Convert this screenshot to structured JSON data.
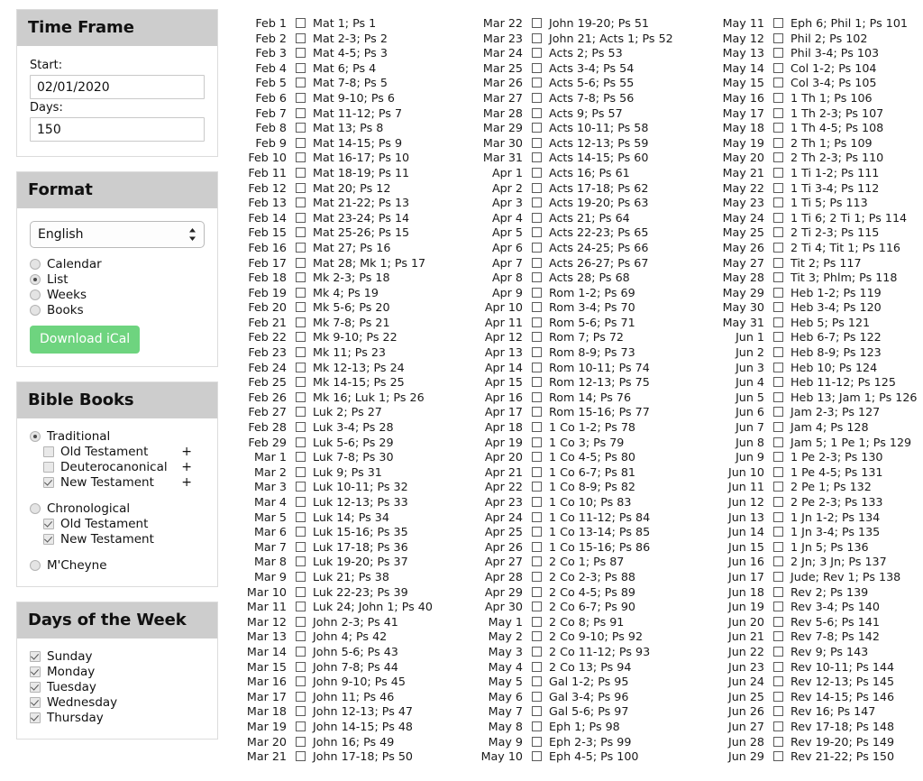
{
  "sidebar": {
    "time_frame": {
      "title": "Time Frame",
      "start_label": "Start:",
      "start_value": "02/01/2020",
      "start_placeholder": "mm/dd/yyyy",
      "days_label": "Days:",
      "days_value": "150",
      "days_placeholder": "Days"
    },
    "format": {
      "title": "Format",
      "language_selected": "English",
      "language_options": [
        "English"
      ],
      "options": [
        {
          "label": "Calendar",
          "selected": false
        },
        {
          "label": "List",
          "selected": true
        },
        {
          "label": "Weeks",
          "selected": false
        },
        {
          "label": "Books",
          "selected": false
        }
      ],
      "download_label": "Download iCal",
      "download_color": "#6ed47f"
    },
    "bible_books": {
      "title": "Bible Books",
      "groups": [
        {
          "label": "Traditional",
          "selected": true,
          "children": [
            {
              "label": "Old Testament",
              "checked": false,
              "expander": "+"
            },
            {
              "label": "Deuterocanonical",
              "checked": false,
              "expander": "+"
            },
            {
              "label": "New Testament",
              "checked": true,
              "expander": "+"
            }
          ]
        },
        {
          "label": "Chronological",
          "selected": false,
          "children": [
            {
              "label": "Old Testament",
              "checked": true,
              "expander": ""
            },
            {
              "label": "New Testament",
              "checked": true,
              "expander": ""
            }
          ]
        },
        {
          "label": "M'Cheyne",
          "selected": false,
          "children": []
        }
      ]
    },
    "days_of_week": {
      "title": "Days of the Week",
      "days": [
        {
          "label": "Sunday",
          "checked": true
        },
        {
          "label": "Monday",
          "checked": true
        },
        {
          "label": "Tuesday",
          "checked": true
        },
        {
          "label": "Wednesday",
          "checked": true
        },
        {
          "label": "Thursday",
          "checked": true
        }
      ]
    }
  },
  "reading_plan": {
    "columns": [
      [
        {
          "date": "Feb 1",
          "reading": "Mat 1; Ps 1"
        },
        {
          "date": "Feb 2",
          "reading": "Mat 2-3; Ps 2"
        },
        {
          "date": "Feb 3",
          "reading": "Mat 4-5; Ps 3"
        },
        {
          "date": "Feb 4",
          "reading": "Mat 6; Ps 4"
        },
        {
          "date": "Feb 5",
          "reading": "Mat 7-8; Ps 5"
        },
        {
          "date": "Feb 6",
          "reading": "Mat 9-10; Ps 6"
        },
        {
          "date": "Feb 7",
          "reading": "Mat 11-12; Ps 7"
        },
        {
          "date": "Feb 8",
          "reading": "Mat 13; Ps 8"
        },
        {
          "date": "Feb 9",
          "reading": "Mat 14-15; Ps 9"
        },
        {
          "date": "Feb 10",
          "reading": "Mat 16-17; Ps 10"
        },
        {
          "date": "Feb 11",
          "reading": "Mat 18-19; Ps 11"
        },
        {
          "date": "Feb 12",
          "reading": "Mat 20; Ps 12"
        },
        {
          "date": "Feb 13",
          "reading": "Mat 21-22; Ps 13"
        },
        {
          "date": "Feb 14",
          "reading": "Mat 23-24; Ps 14"
        },
        {
          "date": "Feb 15",
          "reading": "Mat 25-26; Ps 15"
        },
        {
          "date": "Feb 16",
          "reading": "Mat 27; Ps 16"
        },
        {
          "date": "Feb 17",
          "reading": "Mat 28; Mk 1; Ps 17"
        },
        {
          "date": "Feb 18",
          "reading": "Mk 2-3; Ps 18"
        },
        {
          "date": "Feb 19",
          "reading": "Mk 4; Ps 19"
        },
        {
          "date": "Feb 20",
          "reading": "Mk 5-6; Ps 20"
        },
        {
          "date": "Feb 21",
          "reading": "Mk 7-8; Ps 21"
        },
        {
          "date": "Feb 22",
          "reading": "Mk 9-10; Ps 22"
        },
        {
          "date": "Feb 23",
          "reading": "Mk 11; Ps 23"
        },
        {
          "date": "Feb 24",
          "reading": "Mk 12-13; Ps 24"
        },
        {
          "date": "Feb 25",
          "reading": "Mk 14-15; Ps 25"
        },
        {
          "date": "Feb 26",
          "reading": "Mk 16; Luk 1; Ps 26"
        },
        {
          "date": "Feb 27",
          "reading": "Luk 2; Ps 27"
        },
        {
          "date": "Feb 28",
          "reading": "Luk 3-4; Ps 28"
        },
        {
          "date": "Feb 29",
          "reading": "Luk 5-6; Ps 29"
        },
        {
          "date": "Mar 1",
          "reading": "Luk 7-8; Ps 30"
        },
        {
          "date": "Mar 2",
          "reading": "Luk 9; Ps 31"
        },
        {
          "date": "Mar 3",
          "reading": "Luk 10-11; Ps 32"
        },
        {
          "date": "Mar 4",
          "reading": "Luk 12-13; Ps 33"
        },
        {
          "date": "Mar 5",
          "reading": "Luk 14; Ps 34"
        },
        {
          "date": "Mar 6",
          "reading": "Luk 15-16; Ps 35"
        },
        {
          "date": "Mar 7",
          "reading": "Luk 17-18; Ps 36"
        },
        {
          "date": "Mar 8",
          "reading": "Luk 19-20; Ps 37"
        },
        {
          "date": "Mar 9",
          "reading": "Luk 21; Ps 38"
        },
        {
          "date": "Mar 10",
          "reading": "Luk 22-23; Ps 39"
        },
        {
          "date": "Mar 11",
          "reading": "Luk 24; John 1; Ps 40"
        },
        {
          "date": "Mar 12",
          "reading": "John 2-3; Ps 41"
        },
        {
          "date": "Mar 13",
          "reading": "John 4; Ps 42"
        },
        {
          "date": "Mar 14",
          "reading": "John 5-6; Ps 43"
        },
        {
          "date": "Mar 15",
          "reading": "John 7-8; Ps 44"
        },
        {
          "date": "Mar 16",
          "reading": "John 9-10; Ps 45"
        },
        {
          "date": "Mar 17",
          "reading": "John 11; Ps 46"
        },
        {
          "date": "Mar 18",
          "reading": "John 12-13; Ps 47"
        },
        {
          "date": "Mar 19",
          "reading": "John 14-15; Ps 48"
        },
        {
          "date": "Mar 20",
          "reading": "John 16; Ps 49"
        },
        {
          "date": "Mar 21",
          "reading": "John 17-18; Ps 50"
        }
      ],
      [
        {
          "date": "Mar 22",
          "reading": "John 19-20; Ps 51"
        },
        {
          "date": "Mar 23",
          "reading": "John 21; Acts 1; Ps 52"
        },
        {
          "date": "Mar 24",
          "reading": "Acts 2; Ps 53"
        },
        {
          "date": "Mar 25",
          "reading": "Acts 3-4; Ps 54"
        },
        {
          "date": "Mar 26",
          "reading": "Acts 5-6; Ps 55"
        },
        {
          "date": "Mar 27",
          "reading": "Acts 7-8; Ps 56"
        },
        {
          "date": "Mar 28",
          "reading": "Acts 9; Ps 57"
        },
        {
          "date": "Mar 29",
          "reading": "Acts 10-11; Ps 58"
        },
        {
          "date": "Mar 30",
          "reading": "Acts 12-13; Ps 59"
        },
        {
          "date": "Mar 31",
          "reading": "Acts 14-15; Ps 60"
        },
        {
          "date": "Apr 1",
          "reading": "Acts 16; Ps 61"
        },
        {
          "date": "Apr 2",
          "reading": "Acts 17-18; Ps 62"
        },
        {
          "date": "Apr 3",
          "reading": "Acts 19-20; Ps 63"
        },
        {
          "date": "Apr 4",
          "reading": "Acts 21; Ps 64"
        },
        {
          "date": "Apr 5",
          "reading": "Acts 22-23; Ps 65"
        },
        {
          "date": "Apr 6",
          "reading": "Acts 24-25; Ps 66"
        },
        {
          "date": "Apr 7",
          "reading": "Acts 26-27; Ps 67"
        },
        {
          "date": "Apr 8",
          "reading": "Acts 28; Ps 68"
        },
        {
          "date": "Apr 9",
          "reading": "Rom 1-2; Ps 69"
        },
        {
          "date": "Apr 10",
          "reading": "Rom 3-4; Ps 70"
        },
        {
          "date": "Apr 11",
          "reading": "Rom 5-6; Ps 71"
        },
        {
          "date": "Apr 12",
          "reading": "Rom 7; Ps 72"
        },
        {
          "date": "Apr 13",
          "reading": "Rom 8-9; Ps 73"
        },
        {
          "date": "Apr 14",
          "reading": "Rom 10-11; Ps 74"
        },
        {
          "date": "Apr 15",
          "reading": "Rom 12-13; Ps 75"
        },
        {
          "date": "Apr 16",
          "reading": "Rom 14; Ps 76"
        },
        {
          "date": "Apr 17",
          "reading": "Rom 15-16; Ps 77"
        },
        {
          "date": "Apr 18",
          "reading": "1 Co 1-2; Ps 78"
        },
        {
          "date": "Apr 19",
          "reading": "1 Co 3; Ps 79"
        },
        {
          "date": "Apr 20",
          "reading": "1 Co 4-5; Ps 80"
        },
        {
          "date": "Apr 21",
          "reading": "1 Co 6-7; Ps 81"
        },
        {
          "date": "Apr 22",
          "reading": "1 Co 8-9; Ps 82"
        },
        {
          "date": "Apr 23",
          "reading": "1 Co 10; Ps 83"
        },
        {
          "date": "Apr 24",
          "reading": "1 Co 11-12; Ps 84"
        },
        {
          "date": "Apr 25",
          "reading": "1 Co 13-14; Ps 85"
        },
        {
          "date": "Apr 26",
          "reading": "1 Co 15-16; Ps 86"
        },
        {
          "date": "Apr 27",
          "reading": "2 Co 1; Ps 87"
        },
        {
          "date": "Apr 28",
          "reading": "2 Co 2-3; Ps 88"
        },
        {
          "date": "Apr 29",
          "reading": "2 Co 4-5; Ps 89"
        },
        {
          "date": "Apr 30",
          "reading": "2 Co 6-7; Ps 90"
        },
        {
          "date": "May 1",
          "reading": "2 Co 8; Ps 91"
        },
        {
          "date": "May 2",
          "reading": "2 Co 9-10; Ps 92"
        },
        {
          "date": "May 3",
          "reading": "2 Co 11-12; Ps 93"
        },
        {
          "date": "May 4",
          "reading": "2 Co 13; Ps 94"
        },
        {
          "date": "May 5",
          "reading": "Gal 1-2; Ps 95"
        },
        {
          "date": "May 6",
          "reading": "Gal 3-4; Ps 96"
        },
        {
          "date": "May 7",
          "reading": "Gal 5-6; Ps 97"
        },
        {
          "date": "May 8",
          "reading": "Eph 1; Ps 98"
        },
        {
          "date": "May 9",
          "reading": "Eph 2-3; Ps 99"
        },
        {
          "date": "May 10",
          "reading": "Eph 4-5; Ps 100"
        }
      ],
      [
        {
          "date": "May 11",
          "reading": "Eph 6; Phil 1; Ps 101"
        },
        {
          "date": "May 12",
          "reading": "Phil 2; Ps 102"
        },
        {
          "date": "May 13",
          "reading": "Phil 3-4; Ps 103"
        },
        {
          "date": "May 14",
          "reading": "Col 1-2; Ps 104"
        },
        {
          "date": "May 15",
          "reading": "Col 3-4; Ps 105"
        },
        {
          "date": "May 16",
          "reading": "1 Th 1; Ps 106"
        },
        {
          "date": "May 17",
          "reading": "1 Th 2-3; Ps 107"
        },
        {
          "date": "May 18",
          "reading": "1 Th 4-5; Ps 108"
        },
        {
          "date": "May 19",
          "reading": "2 Th 1; Ps 109"
        },
        {
          "date": "May 20",
          "reading": "2 Th 2-3; Ps 110"
        },
        {
          "date": "May 21",
          "reading": "1 Ti 1-2; Ps 111"
        },
        {
          "date": "May 22",
          "reading": "1 Ti 3-4; Ps 112"
        },
        {
          "date": "May 23",
          "reading": "1 Ti 5; Ps 113"
        },
        {
          "date": "May 24",
          "reading": "1 Ti 6; 2 Ti 1; Ps 114"
        },
        {
          "date": "May 25",
          "reading": "2 Ti 2-3; Ps 115"
        },
        {
          "date": "May 26",
          "reading": "2 Ti 4; Tit 1; Ps 116"
        },
        {
          "date": "May 27",
          "reading": "Tit 2; Ps 117"
        },
        {
          "date": "May 28",
          "reading": "Tit 3; Phlm; Ps 118"
        },
        {
          "date": "May 29",
          "reading": "Heb 1-2; Ps 119"
        },
        {
          "date": "May 30",
          "reading": "Heb 3-4; Ps 120"
        },
        {
          "date": "May 31",
          "reading": "Heb 5; Ps 121"
        },
        {
          "date": "Jun 1",
          "reading": "Heb 6-7; Ps 122"
        },
        {
          "date": "Jun 2",
          "reading": "Heb 8-9; Ps 123"
        },
        {
          "date": "Jun 3",
          "reading": "Heb 10; Ps 124"
        },
        {
          "date": "Jun 4",
          "reading": "Heb 11-12; Ps 125"
        },
        {
          "date": "Jun 5",
          "reading": "Heb 13; Jam 1; Ps 126"
        },
        {
          "date": "Jun 6",
          "reading": "Jam 2-3; Ps 127"
        },
        {
          "date": "Jun 7",
          "reading": "Jam 4; Ps 128"
        },
        {
          "date": "Jun 8",
          "reading": "Jam 5; 1 Pe 1; Ps 129"
        },
        {
          "date": "Jun 9",
          "reading": "1 Pe 2-3; Ps 130"
        },
        {
          "date": "Jun 10",
          "reading": "1 Pe 4-5; Ps 131"
        },
        {
          "date": "Jun 11",
          "reading": "2 Pe 1; Ps 132"
        },
        {
          "date": "Jun 12",
          "reading": "2 Pe 2-3; Ps 133"
        },
        {
          "date": "Jun 13",
          "reading": "1 Jn 1-2; Ps 134"
        },
        {
          "date": "Jun 14",
          "reading": "1 Jn 3-4; Ps 135"
        },
        {
          "date": "Jun 15",
          "reading": "1 Jn 5; Ps 136"
        },
        {
          "date": "Jun 16",
          "reading": "2 Jn; 3 Jn; Ps 137"
        },
        {
          "date": "Jun 17",
          "reading": "Jude; Rev 1; Ps 138"
        },
        {
          "date": "Jun 18",
          "reading": "Rev 2; Ps 139"
        },
        {
          "date": "Jun 19",
          "reading": "Rev 3-4; Ps 140"
        },
        {
          "date": "Jun 20",
          "reading": "Rev 5-6; Ps 141"
        },
        {
          "date": "Jun 21",
          "reading": "Rev 7-8; Ps 142"
        },
        {
          "date": "Jun 22",
          "reading": "Rev 9; Ps 143"
        },
        {
          "date": "Jun 23",
          "reading": "Rev 10-11; Ps 144"
        },
        {
          "date": "Jun 24",
          "reading": "Rev 12-13; Ps 145"
        },
        {
          "date": "Jun 25",
          "reading": "Rev 14-15; Ps 146"
        },
        {
          "date": "Jun 26",
          "reading": "Rev 16; Ps 147"
        },
        {
          "date": "Jun 27",
          "reading": "Rev 17-18; Ps 148"
        },
        {
          "date": "Jun 28",
          "reading": "Rev 19-20; Ps 149"
        },
        {
          "date": "Jun 29",
          "reading": "Rev 21-22; Ps 150"
        }
      ]
    ]
  }
}
